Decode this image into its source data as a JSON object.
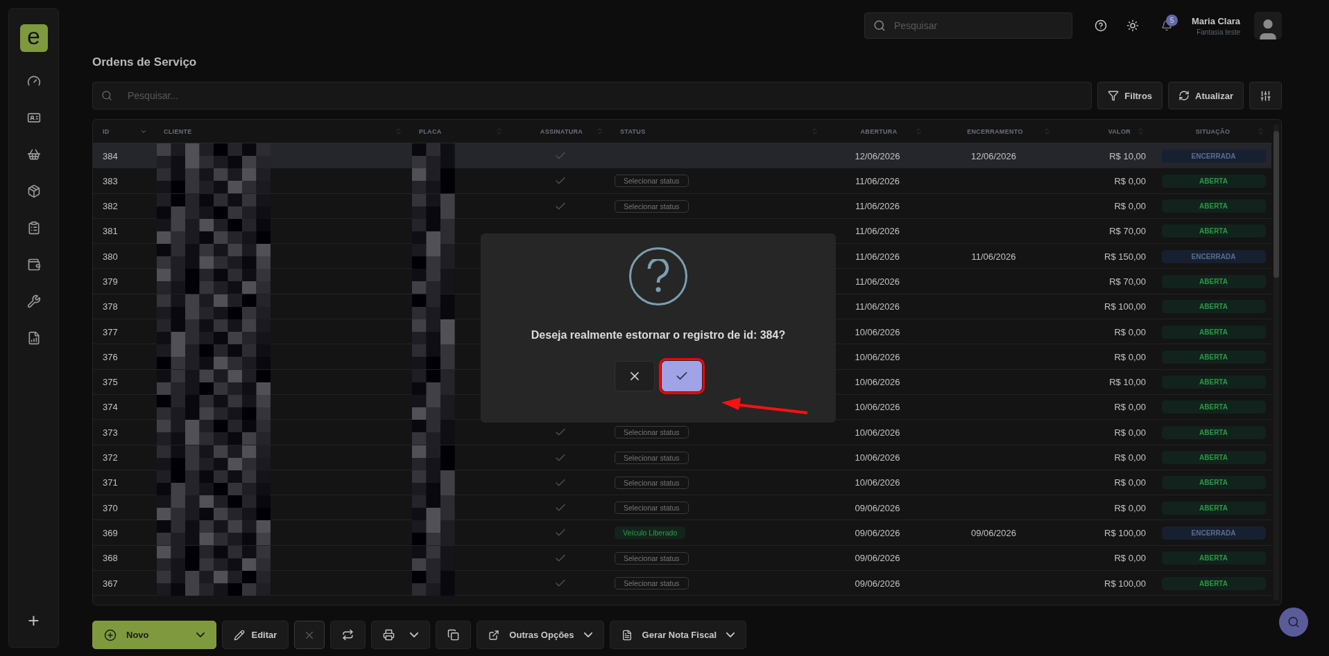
{
  "sidebar": {
    "logo": "e",
    "items": [
      {
        "kind": "dashboard"
      },
      {
        "kind": "card"
      },
      {
        "kind": "basket"
      },
      {
        "kind": "box"
      },
      {
        "kind": "invoice"
      },
      {
        "kind": "bag"
      },
      {
        "kind": "wrench"
      },
      {
        "kind": "report"
      }
    ],
    "add_button": "+"
  },
  "topbar": {
    "search": {
      "placeholder": "Pesquisar"
    },
    "notifications": "5",
    "user": {
      "name": "Maria Clara",
      "company": "Fantasia teste"
    }
  },
  "page_title": "Ordens de Serviço",
  "filter_bar": {
    "search": {
      "placeholder": "Pesquisar..."
    },
    "buttons": [
      {
        "label": "Filtros",
        "kind": "filter"
      },
      {
        "label": "Atualizar",
        "kind": "refresh"
      }
    ]
  },
  "table": {
    "columns": [
      {
        "label": "ID",
        "sorted": true
      },
      {
        "label": "CLIENTE",
        "sorted": false
      },
      {
        "label": "PLACA",
        "sorted": false
      },
      {
        "label": "ASSINATURA",
        "sorted": false
      },
      {
        "label": "STATUS",
        "sorted": false
      },
      {
        "label": "ABERTURA",
        "sorted": false
      },
      {
        "label": "ENCERRAMENTO",
        "sorted": false
      },
      {
        "label": "VALOR",
        "sorted": false
      },
      {
        "label": "SITUAÇÃO",
        "sorted": false
      }
    ],
    "rows": [
      {
        "id": "384",
        "selected": true,
        "signed": true,
        "abertura": "12/06/2026",
        "encerramento": "12/06/2026",
        "valor": "R$ 10,00",
        "situacao": {
          "label": "ENCERRADA",
          "kind": "closed"
        }
      },
      {
        "id": "383",
        "selected": false,
        "signed": true,
        "status": {
          "kind": "select",
          "label": "Selecionar status"
        },
        "abertura": "11/06/2026",
        "valor": "R$ 0,00",
        "situacao": {
          "label": "ABERTA",
          "kind": "open"
        }
      },
      {
        "id": "382",
        "selected": false,
        "signed": true,
        "status": {
          "kind": "select",
          "label": "Selecionar status"
        },
        "abertura": "11/06/2026",
        "valor": "R$ 0,00",
        "situacao": {
          "label": "ABERTA",
          "kind": "open"
        }
      },
      {
        "id": "381",
        "selected": false,
        "abertura": "11/06/2026",
        "valor": "R$ 70,00",
        "situacao": {
          "label": "ABERTA",
          "kind": "open"
        }
      },
      {
        "id": "380",
        "selected": false,
        "abertura": "11/06/2026",
        "encerramento": "11/06/2026",
        "valor": "R$ 150,00",
        "situacao": {
          "label": "ENCERRADA",
          "kind": "closed"
        }
      },
      {
        "id": "379",
        "selected": false,
        "abertura": "11/06/2026",
        "valor": "R$ 70,00",
        "situacao": {
          "label": "ABERTA",
          "kind": "open"
        }
      },
      {
        "id": "378",
        "selected": false,
        "abertura": "11/06/2026",
        "valor": "R$ 100,00",
        "situacao": {
          "label": "ABERTA",
          "kind": "open"
        }
      },
      {
        "id": "377",
        "selected": false,
        "abertura": "10/06/2026",
        "valor": "R$ 0,00",
        "situacao": {
          "label": "ABERTA",
          "kind": "open"
        }
      },
      {
        "id": "376",
        "selected": false,
        "abertura": "10/06/2026",
        "valor": "R$ 0,00",
        "situacao": {
          "label": "ABERTA",
          "kind": "open"
        }
      },
      {
        "id": "375",
        "selected": false,
        "abertura": "10/06/2026",
        "valor": "R$ 10,00",
        "situacao": {
          "label": "ABERTA",
          "kind": "open"
        }
      },
      {
        "id": "374",
        "selected": false,
        "abertura": "10/06/2026",
        "valor": "R$ 0,00",
        "situacao": {
          "label": "ABERTA",
          "kind": "open"
        }
      },
      {
        "id": "373",
        "selected": false,
        "signed": true,
        "status": {
          "kind": "select",
          "label": "Selecionar status"
        },
        "abertura": "10/06/2026",
        "valor": "R$ 0,00",
        "situacao": {
          "label": "ABERTA",
          "kind": "open"
        }
      },
      {
        "id": "372",
        "selected": false,
        "signed": true,
        "status": {
          "kind": "select",
          "label": "Selecionar status"
        },
        "abertura": "10/06/2026",
        "valor": "R$ 0,00",
        "situacao": {
          "label": "ABERTA",
          "kind": "open"
        }
      },
      {
        "id": "371",
        "selected": false,
        "signed": true,
        "status": {
          "kind": "select",
          "label": "Selecionar status"
        },
        "abertura": "10/06/2026",
        "valor": "R$ 0,00",
        "situacao": {
          "label": "ABERTA",
          "kind": "open"
        }
      },
      {
        "id": "370",
        "selected": false,
        "signed": true,
        "status": {
          "kind": "select",
          "label": "Selecionar status"
        },
        "abertura": "09/06/2026",
        "valor": "R$ 0,00",
        "situacao": {
          "label": "ABERTA",
          "kind": "open"
        }
      },
      {
        "id": "369",
        "selected": false,
        "signed": true,
        "status": {
          "kind": "tag",
          "label": "Veículo Liberado"
        },
        "abertura": "09/06/2026",
        "encerramento": "09/06/2026",
        "valor": "R$ 100,00",
        "situacao": {
          "label": "ENCERRADA",
          "kind": "closed"
        }
      },
      {
        "id": "368",
        "selected": false,
        "signed": true,
        "status": {
          "kind": "select",
          "label": "Selecionar status"
        },
        "abertura": "09/06/2026",
        "valor": "R$ 0,00",
        "situacao": {
          "label": "ABERTA",
          "kind": "open"
        }
      },
      {
        "id": "367",
        "selected": false,
        "signed": true,
        "status": {
          "kind": "select",
          "label": "Selecionar status"
        },
        "abertura": "09/06/2026",
        "valor": "R$ 100,00",
        "situacao": {
          "label": "ABERTA",
          "kind": "open"
        }
      }
    ]
  },
  "toolbar": [
    {
      "kind": "new",
      "label": "Novo"
    },
    {
      "kind": "edit",
      "label": "Editar"
    },
    {
      "kind": "delete",
      "disabled": true
    },
    {
      "kind": "swap"
    },
    {
      "kind": "print"
    },
    {
      "kind": "copy"
    },
    {
      "kind": "more",
      "label": "Outras Opções"
    },
    {
      "kind": "invoice",
      "label": "Gerar Nota Fiscal"
    }
  ],
  "dialog": {
    "message": "Deseja realmente estornar o registro de id: 384?",
    "buttons": [
      {
        "kind": "cancel",
        "highlighted": false
      },
      {
        "kind": "confirm",
        "highlighted": true
      }
    ]
  }
}
